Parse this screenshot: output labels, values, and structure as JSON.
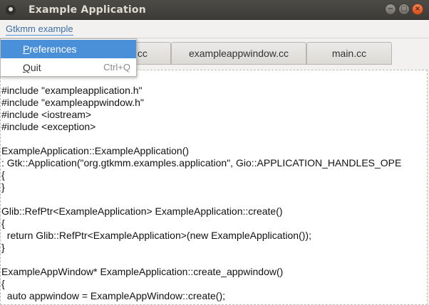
{
  "window": {
    "title": "Example Application",
    "buttons": {
      "minimize": "−",
      "maximize": "□",
      "close": "×"
    }
  },
  "menubar": {
    "menu_label": "Gtkmm example"
  },
  "menu": {
    "items": [
      {
        "label_first": "P",
        "label_rest": "references",
        "accel": ""
      },
      {
        "label_first": "Q",
        "label_rest": "uit",
        "accel": "Ctrl+Q"
      }
    ]
  },
  "tabs": [
    {
      "label": "n.cc"
    },
    {
      "label": "exampleappwindow.cc"
    },
    {
      "label": "main.cc"
    }
  ],
  "editor": {
    "code": "#include \"exampleapplication.h\"\n#include \"exampleappwindow.h\"\n#include <iostream>\n#include <exception>\n\nExampleApplication::ExampleApplication()\n: Gtk::Application(\"org.gtkmm.examples.application\", Gio::APPLICATION_HANDLES_OPE\n{\n}\n\nGlib::RefPtr<ExampleApplication> ExampleApplication::create()\n{\n  return Glib::RefPtr<ExampleApplication>(new ExampleApplication());\n}\n\nExampleAppWindow* ExampleApplication::create_appwindow()\n{\n  auto appwindow = ExampleAppWindow::create();"
  },
  "colors": {
    "titlebar": "#3d3c38",
    "selection": "#4a90d9",
    "close_button": "#e05a24"
  }
}
